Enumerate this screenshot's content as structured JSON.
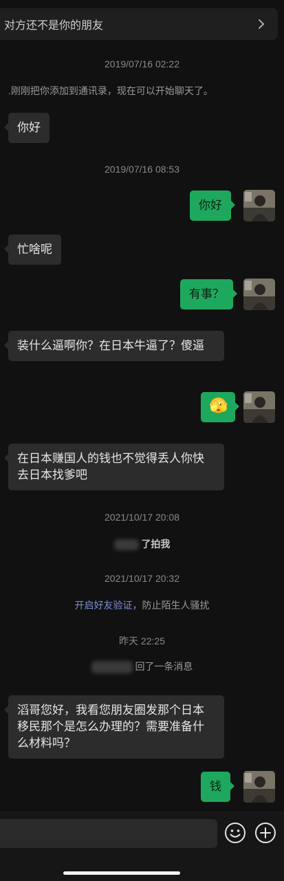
{
  "banner": {
    "text": "对方还不是你的朋友",
    "chevron_icon": "chevron-right-icon"
  },
  "messages": {
    "ts1": "2019/07/16 02:22",
    "sys_added": ".刚刚把你添加到通讯录，现在可以开始聊天了。",
    "m1": "你好",
    "ts2": "2019/07/16 08:53",
    "m2": "你好",
    "m3": "忙啥呢",
    "m4": "有事？",
    "m5": "装什么逼啊你？在日本牛逼了？傻逼",
    "m6_emoji": "🫣",
    "m7": "在日本赚国人的钱也不觉得丢人你快去日本找爹吧",
    "ts3": "2021/10/17 20:08",
    "sys_pat": "了拍我",
    "ts4": "2021/10/17 20:32",
    "sys_verify_link": "开启好友验证",
    "sys_verify_rest": "，防止陌生人骚扰",
    "ts5": "昨天 22:25",
    "sys_recall": "回了一条消息",
    "m8": "滔哥您好，我看您朋友圈发那个日本移民那个是怎么办理的？需要准备什么材料吗？",
    "m9": "钱"
  },
  "composer": {
    "emoji_icon": "smiley-icon",
    "plus_icon": "plus-circle-icon"
  }
}
